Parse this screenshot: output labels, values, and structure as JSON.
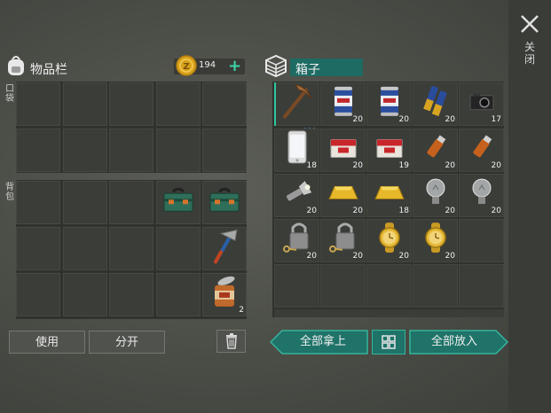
{
  "inventory": {
    "title": "物品栏",
    "coins": "194",
    "pockets_label": "口袋",
    "backpack_label": "背包"
  },
  "box": {
    "title": "箱子",
    "slots": [
      {
        "icon": "pickaxe-icon",
        "qty": ""
      },
      {
        "icon": "soda-can-icon",
        "qty": "20"
      },
      {
        "icon": "soda-can-icon",
        "qty": "20"
      },
      {
        "icon": "batteries-icon",
        "qty": "20"
      },
      {
        "icon": "camera-icon",
        "qty": "17"
      },
      {
        "icon": "smartphone-icon",
        "qty": "18"
      },
      {
        "icon": "cigarettes-icon",
        "qty": "20"
      },
      {
        "icon": "cigarettes-icon",
        "qty": "19"
      },
      {
        "icon": "usb-drive-icon",
        "qty": "20"
      },
      {
        "icon": "usb-drive-icon",
        "qty": "20"
      },
      {
        "icon": "flashlight-icon",
        "qty": "20"
      },
      {
        "icon": "gold-bar-icon",
        "qty": "20"
      },
      {
        "icon": "gold-bar-icon",
        "qty": "18"
      },
      {
        "icon": "light-bulb-icon",
        "qty": "20"
      },
      {
        "icon": "light-bulb-icon",
        "qty": "20"
      },
      {
        "icon": "padlock-key-icon",
        "qty": "20"
      },
      {
        "icon": "padlock-key-icon",
        "qty": "20"
      },
      {
        "icon": "gold-watch-icon",
        "qty": "20"
      },
      {
        "icon": "gold-watch-icon",
        "qty": "20"
      }
    ]
  },
  "backpack_items": [
    {
      "icon": "toolbox-icon",
      "qty": ""
    },
    {
      "icon": "toolbox-icon",
      "qty": ""
    },
    {
      "icon": "hammer-icon",
      "qty": ""
    },
    {
      "icon": "tin-can-icon",
      "qty": "2"
    }
  ],
  "buttons": {
    "use": "使用",
    "split": "分开",
    "take_all": "全部拿上",
    "put_all": "全部放入"
  },
  "close_label": "关闭",
  "colors": {
    "accent": "#2fc7a0",
    "teal_button": "#1f7369",
    "coin": "#d9a21c"
  }
}
